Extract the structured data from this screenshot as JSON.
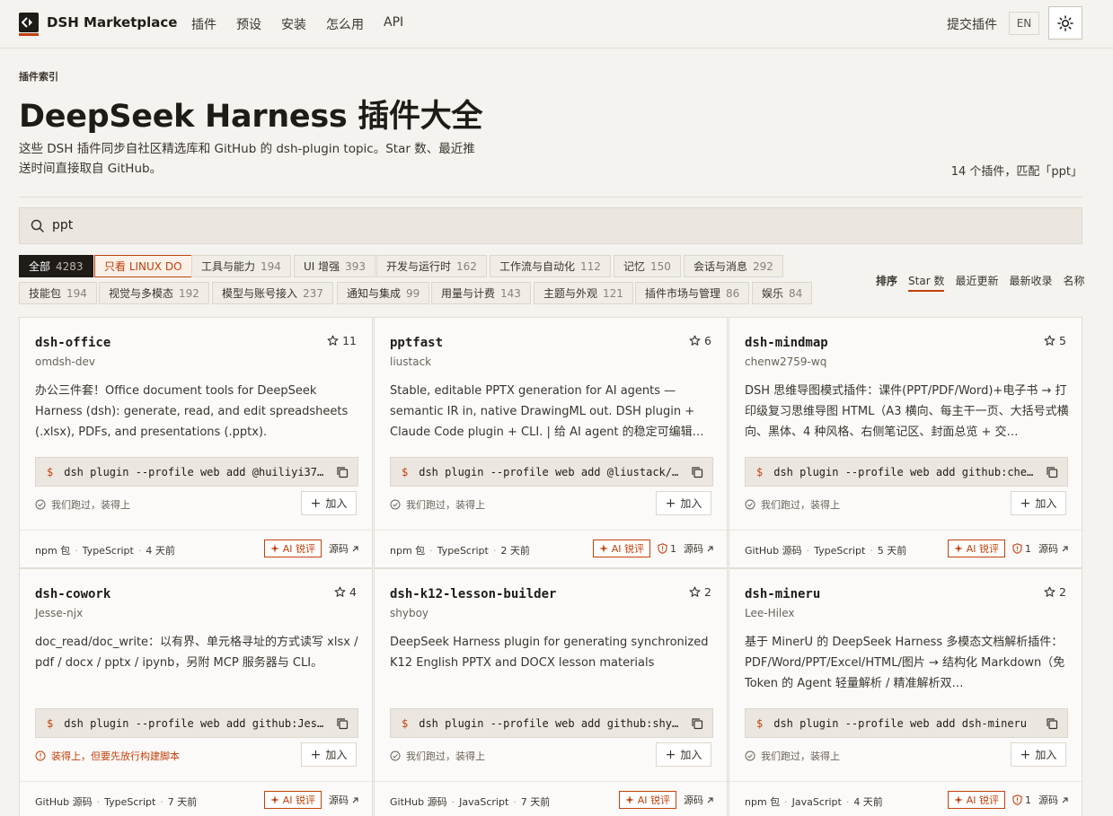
{
  "header": {
    "brand": "DSH Marketplace",
    "nav": [
      "插件",
      "预设",
      "安装",
      "怎么用",
      "API"
    ],
    "submit": "提交插件",
    "lang": "EN"
  },
  "hero": {
    "eyebrow": "插件索引",
    "title": "DeepSeek Harness 插件大全",
    "desc_line1": "这些 DSH 插件同步自社区精选库和 GitHub 的 dsh-plugin topic。Star 数、最近推",
    "desc_line2": "送时间直接取自 GitHub。",
    "count": "14 个插件，匹配「ppt」"
  },
  "search": {
    "value": "ppt"
  },
  "filters": {
    "row1": [
      {
        "label": "全部",
        "count": "4283"
      },
      {
        "label": "只看 LINUX DO",
        "count": ""
      },
      {
        "label": "工具与能力",
        "count": "194"
      },
      {
        "label": "UI 增强",
        "count": "393"
      },
      {
        "label": "开发与运行时",
        "count": "162"
      },
      {
        "label": "工作流与自动化",
        "count": "112"
      },
      {
        "label": "记忆",
        "count": "150"
      },
      {
        "label": "会话与消息",
        "count": "292"
      }
    ],
    "row2": [
      {
        "label": "技能包",
        "count": "194"
      },
      {
        "label": "视觉与多模态",
        "count": "192"
      },
      {
        "label": "模型与账号接入",
        "count": "237"
      },
      {
        "label": "通知与集成",
        "count": "99"
      },
      {
        "label": "用量与计费",
        "count": "143"
      },
      {
        "label": "主题与外观",
        "count": "121"
      },
      {
        "label": "插件市场与管理",
        "count": "86"
      },
      {
        "label": "娱乐",
        "count": "84"
      }
    ]
  },
  "sort": {
    "label": "排序",
    "options": [
      "Star 数",
      "最近更新",
      "最新收录",
      "名称"
    ]
  },
  "cards": [
    {
      "name": "dsh-office",
      "owner": "omdsh-dev",
      "stars": "11",
      "desc": "办公三件套！Office document tools for DeepSeek Harness (dsh): generate, read, and edit spreadsheets (.xlsx), PDFs, and presentations (.pptx).",
      "cmd": "dsh plugin --profile web add @huiliyi37…",
      "status": "我们跑过，装得上",
      "join": "加入",
      "source": "npm 包",
      "lang": "TypeScript",
      "time": "4 天前",
      "ai": "AI 锐评",
      "risk": "",
      "src": "源码"
    },
    {
      "name": "pptfast",
      "owner": "liustack",
      "stars": "6",
      "desc": "Stable, editable PPTX generation for AI agents — semantic IR in, native DrawingML out. DSH plugin + Claude Code plugin + CLI. | 给 AI agent 的稳定可编辑…",
      "cmd": "dsh plugin --profile web add @liustack/…",
      "status": "我们跑过，装得上",
      "join": "加入",
      "source": "npm 包",
      "lang": "TypeScript",
      "time": "2 天前",
      "ai": "AI 锐评",
      "risk": "1",
      "src": "源码"
    },
    {
      "name": "dsh-mindmap",
      "owner": "chenw2759-wq",
      "stars": "5",
      "desc": "DSH 思维导图模式插件：课件(PPT/PDF/Word)+电子书 → 打印级复习思维导图 HTML（A3 横向、每主干一页、大括号式横向、黑体、4 种风格、右侧笔记区、封面总览 + 交…",
      "cmd": "dsh plugin --profile web add github:che…",
      "status": "我们跑过，装得上",
      "join": "加入",
      "source": "GitHub 源码",
      "lang": "TypeScript",
      "time": "5 天前",
      "ai": "AI 锐评",
      "risk": "1",
      "src": "源码"
    },
    {
      "name": "dsh-cowork",
      "owner": "Jesse-njx",
      "stars": "4",
      "desc": "doc_read/doc_write：以有界、单元格寻址的方式读写 xlsx / pdf / docx / pptx / ipynb，另附 MCP 服务器与 CLI。",
      "cmd": "dsh plugin --profile web add github:Jes…",
      "status": "装得上，但要先放行构建脚本",
      "join": "加入",
      "source": "GitHub 源码",
      "lang": "TypeScript",
      "time": "7 天前",
      "ai": "AI 锐评",
      "risk": "",
      "src": "源码"
    },
    {
      "name": "dsh-k12-lesson-builder",
      "owner": "shyboy",
      "stars": "2",
      "desc": "DeepSeek Harness plugin for generating synchronized K12 English PPTX and DOCX lesson materials",
      "cmd": "dsh plugin --profile web add github:shy…",
      "status": "我们跑过，装得上",
      "join": "加入",
      "source": "GitHub 源码",
      "lang": "JavaScript",
      "time": "7 天前",
      "ai": "AI 锐评",
      "risk": "",
      "src": "源码"
    },
    {
      "name": "dsh-mineru",
      "owner": "Lee-Hilex",
      "stars": "2",
      "desc": "基于 MinerU 的 DeepSeek Harness 多模态文档解析插件：PDF/Word/PPT/Excel/HTML/图片 → 结构化 Markdown（免 Token 的 Agent 轻量解析 / 精准解析双…",
      "cmd": "dsh plugin --profile web add dsh-mineru",
      "status": "我们跑过，装得上",
      "join": "加入",
      "source": "npm 包",
      "lang": "JavaScript",
      "time": "4 天前",
      "ai": "AI 锐评",
      "risk": "1",
      "src": "源码"
    }
  ]
}
